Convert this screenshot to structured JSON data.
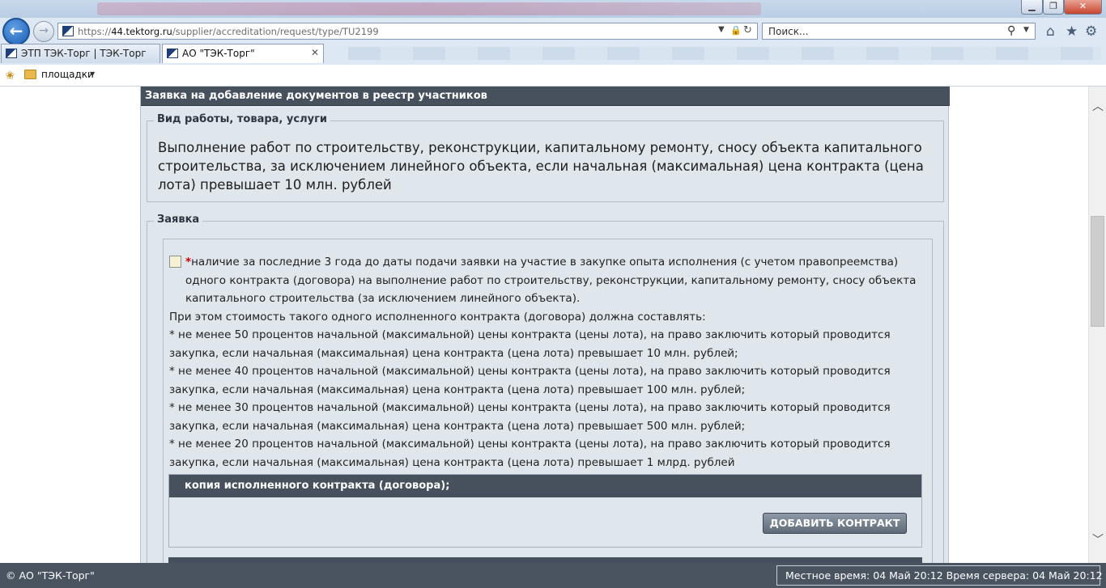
{
  "browser": {
    "address_url_scheme": "https://",
    "address_url_host": "44.tektorg.ru",
    "address_url_path": "/supplier/accreditation/request/type/TU2199",
    "search_placeholder": "Поиск...",
    "tabs": [
      {
        "label": "ЭТП ТЭК-Торг | ТЭК-Торг"
      },
      {
        "label": "АО \"ТЭК-Торг\""
      }
    ],
    "favorites": {
      "folder_label": "площадки"
    },
    "icons": {
      "back": "arrow-left-icon",
      "forward": "arrow-right-icon",
      "home": "home-icon",
      "favorites": "star-icon",
      "tools": "gear-icon"
    }
  },
  "form": {
    "header": "Заявка на добавление документов в реестр участников",
    "work_type": {
      "legend": "Вид работы, товара, услуги",
      "text": "Выполнение работ по строительству, реконструкции, капитальному ремонту, сносу объекта капитального строительства, за исключением линейного объекта, если начальная (максимальная) цена контракта (цена лота) превышает 10 млн. рублей"
    },
    "application": {
      "legend": "Заявка",
      "requirement": {
        "required_mark": "*",
        "checked": false,
        "first_line": "наличие за последние 3 года до даты подачи заявки на участие в закупке опыта исполнения (с учетом правопреемства) одного контракта (договора) на выполнение работ по строительству, реконструкции, капитальному ремонту, сносу объекта капитального строительства (за исключением линейного объекта).",
        "cost_intro": "При этом стоимость такого одного исполненного контракта (договора) должна составлять:",
        "conditions": [
          "* не менее 50 процентов начальной (максимальной) цены контракта (цены лота), на право заключить который проводится закупка, если начальная (максимальная) цена контракта (цена лота) превышает 10 млн. рублей;",
          "* не менее 40 процентов начальной (максимальной) цены контракта (цены лота), на право заключить который проводится закупка, если начальная (максимальная) цена контракта (цена лота) превышает 100 млн. рублей;",
          "* не менее 30 процентов начальной (максимальной) цены контракта (цены лота), на право заключить который проводится закупка, если начальная (максимальная) цена контракта (цена лота) превышает 500 млн. рублей;",
          "* не менее 20 процентов начальной (максимальной) цены контракта (цены лота), на право заключить который проводится закупка, если начальная (максимальная) цена контракта (цена лота) превышает 1 млрд. рублей"
        ]
      },
      "contract_copy": {
        "header": "копия исполненного контракта (договора);",
        "add_button_label": "ДОБАВИТЬ КОНТРАКТ"
      }
    }
  },
  "footer": {
    "copyright": "© АО \"ТЭК-Торг\"",
    "time_status": "Местное время: 04 Май 20:12 Время сервера: 04 Май 20:12"
  },
  "colors": {
    "header_bg": "#46515d",
    "panel_bg": "#dfe6ec",
    "required_mark": "#cc0000",
    "button_bg": "#6f7b88"
  }
}
